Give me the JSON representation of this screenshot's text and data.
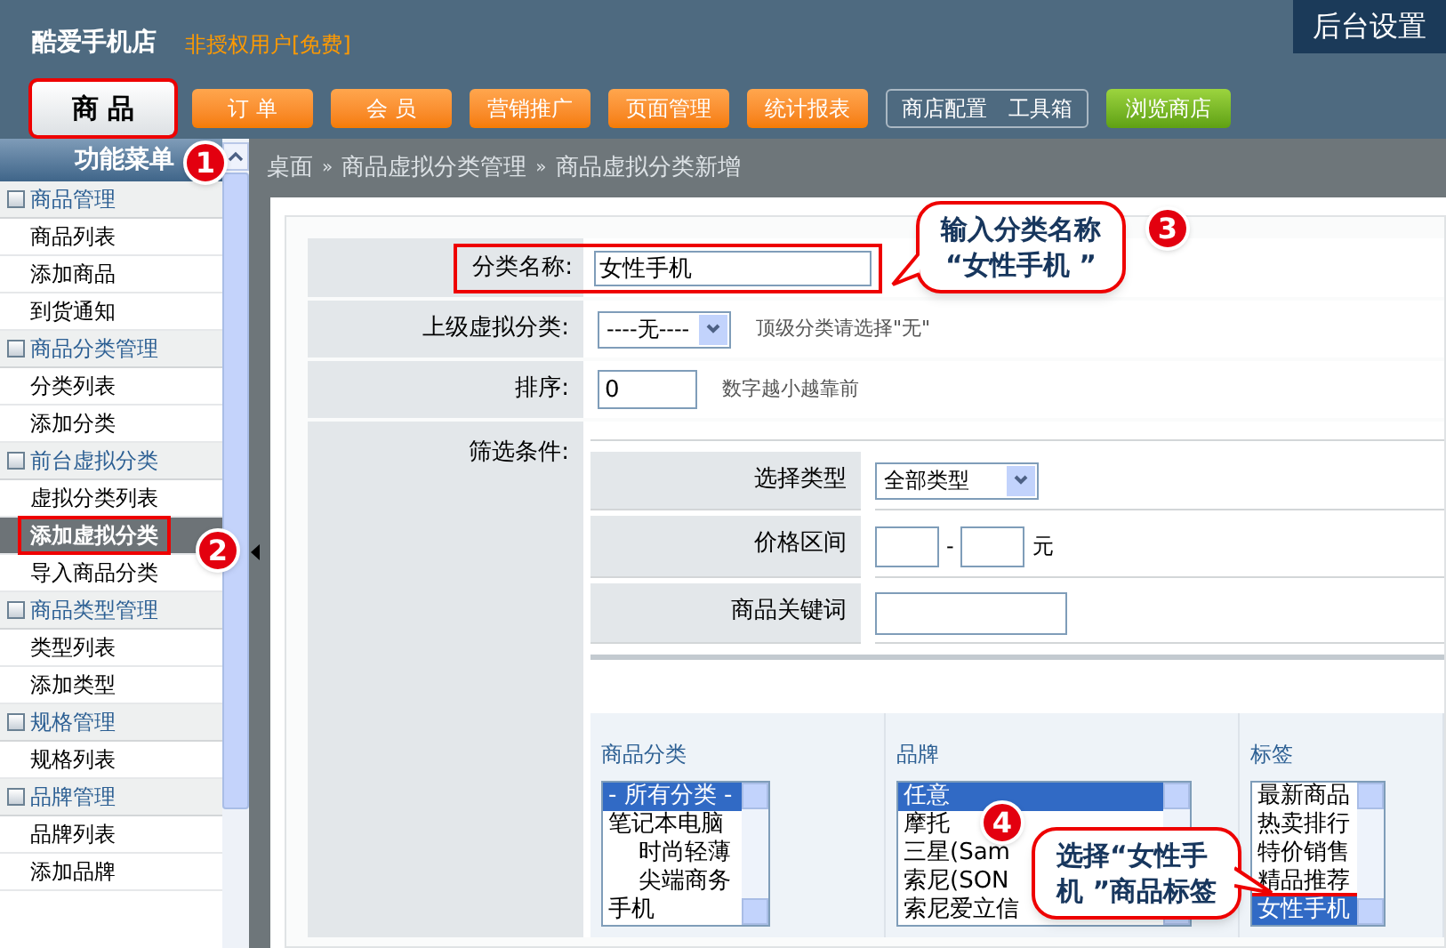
{
  "header": {
    "shop_name": "酷爱手机店",
    "license": "非授权用户[免费]",
    "settings_button": "后台设置"
  },
  "nav_tabs": [
    {
      "label": "商 品",
      "kind": "main",
      "selected": true,
      "highlighted": true
    },
    {
      "label": "订 单",
      "kind": "orange",
      "selected": false,
      "highlighted": false
    },
    {
      "label": "会 员",
      "kind": "orange",
      "selected": false,
      "highlighted": false
    },
    {
      "label": "营销推广",
      "kind": "orange",
      "selected": false,
      "highlighted": false
    },
    {
      "label": "页面管理",
      "kind": "orange",
      "selected": false,
      "highlighted": false
    },
    {
      "label": "统计报表",
      "kind": "orange",
      "selected": false,
      "highlighted": false
    },
    {
      "labels": [
        "商店配置",
        "工具箱"
      ],
      "kind": "tools",
      "selected": false,
      "highlighted": false
    },
    {
      "label": "浏览商店",
      "kind": "green",
      "selected": false,
      "highlighted": false
    }
  ],
  "sidebar": {
    "title": "功能菜单",
    "groups": [
      {
        "label": "商品管理",
        "children": [
          {
            "label": "商品列表",
            "selected": false
          },
          {
            "label": "添加商品",
            "selected": false
          },
          {
            "label": "到货通知",
            "selected": false
          }
        ]
      },
      {
        "label": "商品分类管理",
        "children": [
          {
            "label": "分类列表",
            "selected": false
          },
          {
            "label": "添加分类",
            "selected": false
          }
        ]
      },
      {
        "label": "前台虚拟分类",
        "children": [
          {
            "label": "虚拟分类列表",
            "selected": false
          },
          {
            "label": "添加虚拟分类",
            "selected": true
          },
          {
            "label": "导入商品分类",
            "selected": false
          }
        ]
      },
      {
        "label": "商品类型管理",
        "children": [
          {
            "label": "类型列表",
            "selected": false
          },
          {
            "label": "添加类型",
            "selected": false
          }
        ]
      },
      {
        "label": "规格管理",
        "children": [
          {
            "label": "规格列表",
            "selected": false
          }
        ]
      },
      {
        "label": "品牌管理",
        "children": [
          {
            "label": "品牌列表",
            "selected": false
          },
          {
            "label": "添加品牌",
            "selected": false
          }
        ]
      }
    ]
  },
  "breadcrumb": {
    "separator": "»",
    "items": [
      "桌面",
      "商品虚拟分类管理",
      "商品虚拟分类新增"
    ]
  },
  "form": {
    "name": {
      "label": "分类名称:",
      "value": "女性手机"
    },
    "parent": {
      "label": "上级虚拟分类:",
      "value": "----无----",
      "hint": "顶级分类请选择\"无\""
    },
    "order": {
      "label": "排序:",
      "value": "0",
      "hint": "数字越小越靠前"
    },
    "filter": {
      "label": "筛选条件:",
      "type": {
        "label": "选择类型",
        "value": "全部类型"
      },
      "price": {
        "label": "价格区间",
        "separator": "-",
        "unit": "元"
      },
      "keyword": {
        "label": "商品关键词"
      }
    },
    "lists": [
      {
        "title": "商品分类",
        "options": [
          {
            "label": "- 所有分类 -",
            "selected": true
          },
          {
            "label": "笔记本电脑",
            "selected": false,
            "children": [
              {
                "label": "时尚轻薄",
                "selected": false
              },
              {
                "label": "尖端商务",
                "selected": false
              }
            ]
          },
          {
            "label": "手机",
            "selected": false
          }
        ]
      },
      {
        "title": "品牌",
        "options": [
          {
            "label": "任意",
            "selected": true
          },
          {
            "label": "摩托",
            "selected": false
          },
          {
            "label": "三星(Sam",
            "selected": false
          },
          {
            "label": "索尼(SON",
            "selected": false
          },
          {
            "label": "索尼爱立信",
            "selected": false
          }
        ]
      },
      {
        "title": "标签",
        "options": [
          {
            "label": "最新商品",
            "selected": false
          },
          {
            "label": "热卖排行",
            "selected": false
          },
          {
            "label": "特价销售",
            "selected": false
          },
          {
            "label": "精品推荐",
            "selected": false
          },
          {
            "label": "女性手机",
            "selected": true
          }
        ]
      }
    ]
  },
  "annotations": [
    {
      "number": "1"
    },
    {
      "number": "2"
    },
    {
      "number": "3",
      "lines": [
        "输入分类名称",
        "“女性手机 ”"
      ]
    },
    {
      "number": "4",
      "lines": [
        "选择“女性手",
        "机 ”商品标签"
      ]
    }
  ]
}
